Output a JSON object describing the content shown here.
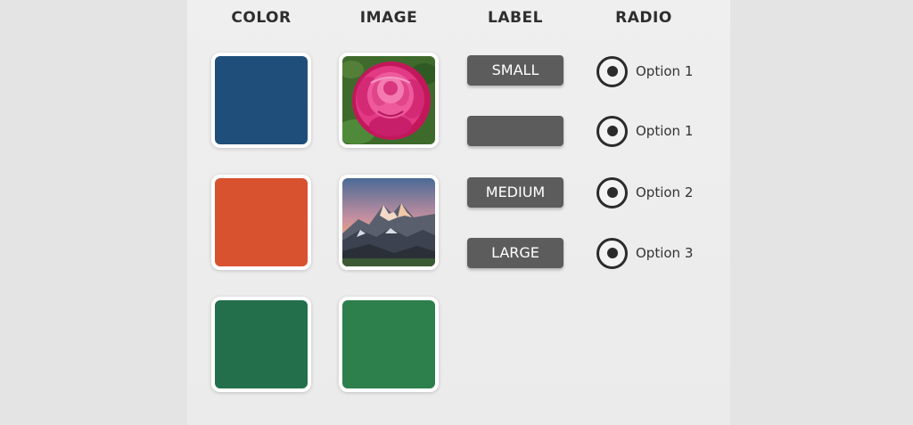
{
  "headers": {
    "color": "COLOR",
    "image": "IMAGE",
    "label": "LABEL",
    "radio": "RADIO"
  },
  "colors": {
    "blue": "#1f4e7a",
    "orange": "#d95230",
    "green": "#246f4b",
    "image_green": "#2d7f4c"
  },
  "images": {
    "row1": "pink-peony-flower",
    "row2": "mountain-sunset",
    "row3": "solid-green"
  },
  "labels": [
    "SMALL",
    "",
    "MEDIUM",
    "LARGE"
  ],
  "radios": [
    {
      "label": "Option 1",
      "selected": true
    },
    {
      "label": "Option 1",
      "selected": true
    },
    {
      "label": "Option 2",
      "selected": true
    },
    {
      "label": "Option 3",
      "selected": true
    }
  ]
}
